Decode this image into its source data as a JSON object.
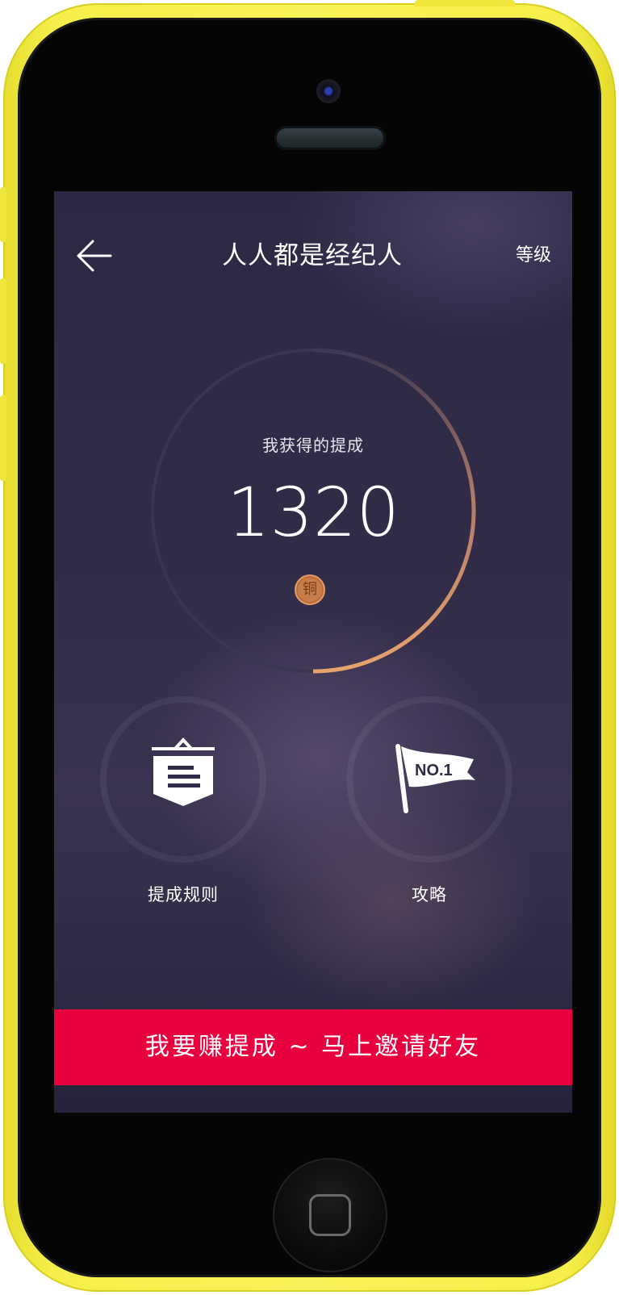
{
  "nav": {
    "title": "人人都是经纪人",
    "back_icon": "arrow-left-icon",
    "level_label": "等级"
  },
  "earnings": {
    "caption": "我获得的提成",
    "value": "1320",
    "tier_badge": "铜",
    "progress_fraction": 0.5,
    "progress_color_start": "#3a3550",
    "progress_color_end": "#e4a06c"
  },
  "actions": [
    {
      "label": "提成规则",
      "icon": "shield-document-icon"
    },
    {
      "label": "攻略",
      "icon": "flag-icon",
      "icon_text": "NO.1"
    }
  ],
  "invite": {
    "label": "我要赚提成 ~ 马上邀请好友",
    "color": "#e8003f"
  }
}
